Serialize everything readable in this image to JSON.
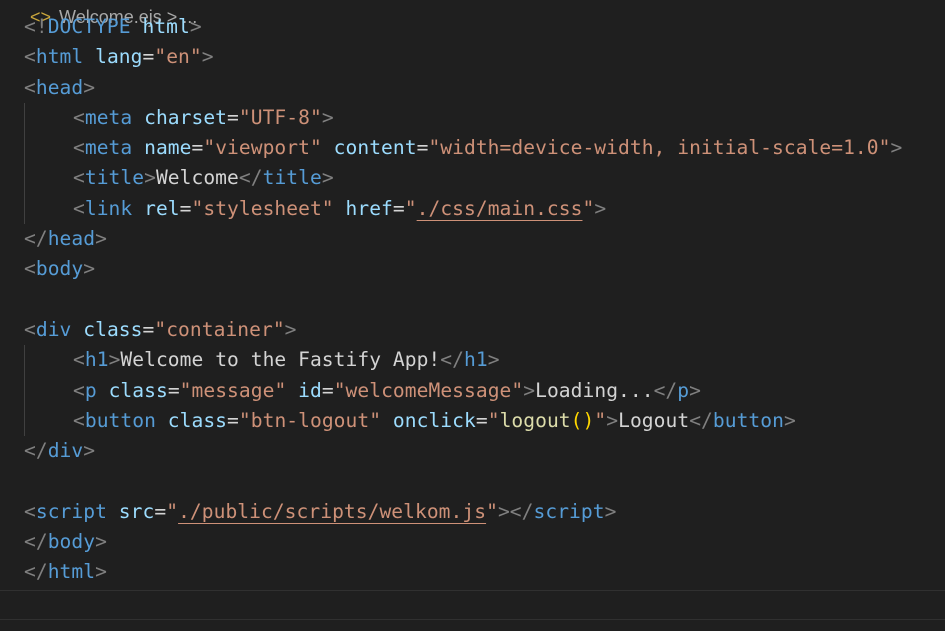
{
  "breadcrumb": {
    "file": "Welcome.ejs",
    "separator": " > ",
    "more": "..."
  },
  "code": {
    "doctype": {
      "open": "<!",
      "keyword": "DOCTYPE",
      "name": " html",
      "close": ">"
    },
    "html_open": {
      "open": "<",
      "tag": "html",
      "attr": " lang",
      "eq": "=",
      "value": "\"en\"",
      "close": ">"
    },
    "head_open": {
      "open": "<",
      "tag": "head",
      "close": ">"
    },
    "meta_charset": {
      "open": "<",
      "tag": "meta",
      "attr": " charset",
      "eq": "=",
      "value": "\"UTF-8\"",
      "close": ">"
    },
    "meta_viewport": {
      "open": "<",
      "tag": "meta",
      "attr1": " name",
      "eq1": "=",
      "value1": "\"viewport\"",
      "attr2": " content",
      "eq2": "=",
      "value2": "\"width=device-width, initial-scale=1.0\"",
      "close": ">"
    },
    "title_line": {
      "open": "<",
      "tag": "title",
      "close": ">",
      "text": "Welcome",
      "end_open": "</",
      "end_tag": "title",
      "end_close": ">"
    },
    "link_line": {
      "open": "<",
      "tag": "link",
      "attr1": " rel",
      "eq1": "=",
      "value1": "\"stylesheet\"",
      "attr2": " href",
      "eq2": "=",
      "q_open": "\"",
      "href": "./css/main.css",
      "q_close": "\"",
      "close": ">"
    },
    "head_close": {
      "open": "</",
      "tag": "head",
      "close": ">"
    },
    "body_open": {
      "open": "<",
      "tag": "body",
      "close": ">"
    },
    "div_open": {
      "open": "<",
      "tag": "div",
      "attr": " class",
      "eq": "=",
      "value": "\"container\"",
      "close": ">"
    },
    "h1_line": {
      "open": "<",
      "tag": "h1",
      "close": ">",
      "text": "Welcome to the Fastify App!",
      "end_open": "</",
      "end_tag": "h1",
      "end_close": ">"
    },
    "p_line": {
      "open": "<",
      "tag": "p",
      "attr1": " class",
      "eq1": "=",
      "value1": "\"message\"",
      "attr2": " id",
      "eq2": "=",
      "value2": "\"welcomeMessage\"",
      "close": ">",
      "text": "Loading...",
      "end_open": "</",
      "end_tag": "p",
      "end_close": ">"
    },
    "button_line": {
      "open": "<",
      "tag": "button",
      "attr1": " class",
      "eq1": "=",
      "value1": "\"btn-logout\"",
      "attr2": " onclick",
      "eq2": "=",
      "q_open": "\"",
      "fn": "logout",
      "parens": "()",
      "q_close": "\"",
      "close": ">",
      "text": "Logout",
      "end_open": "</",
      "end_tag": "button",
      "end_close": ">"
    },
    "div_close": {
      "open": "</",
      "tag": "div",
      "close": ">"
    },
    "script_line": {
      "open": "<",
      "tag": "script",
      "attr": " src",
      "eq": "=",
      "q_open": "\"",
      "src": "./public/scripts/welkom.js",
      "q_close": "\"",
      "close": ">",
      "end_open": "</",
      "end_tag": "script",
      "end_close": ">"
    },
    "body_close": {
      "open": "</",
      "tag": "body",
      "close": ">"
    },
    "html_close": {
      "open": "</",
      "tag": "html",
      "close": ">"
    }
  }
}
